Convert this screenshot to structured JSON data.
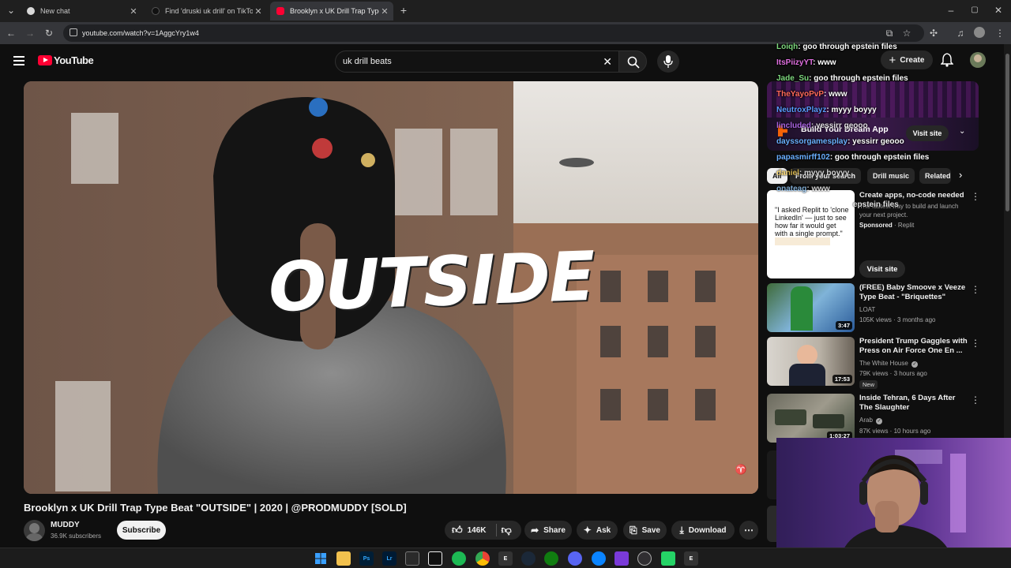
{
  "browser": {
    "tabs": [
      {
        "title": "New chat",
        "favicon_color": "#d9d9d9"
      },
      {
        "title": "Find 'druski uk drill' on TikTok |",
        "favicon_color": "#111111"
      },
      {
        "title": "Brooklyn x UK Drill Trap Type Be",
        "favicon_color": "#ff0033"
      }
    ],
    "new_tab": "+",
    "url": "youtube.com/watch?v=1AggcYry1w4"
  },
  "youtube": {
    "logo_text": "YouTube",
    "search_value": "uk drill beats",
    "create_label": "Create",
    "video": {
      "overlay_word": "OUTSIDE",
      "title": "Brooklyn x UK Drill Trap Type Beat \"OUTSIDE\" | 2020 | @PRODMUDDY [SOLD]",
      "channel": "MUDDY",
      "subscribers": "36.9K subscribers",
      "subscribe_label": "Subscribe",
      "likes": "146K",
      "share_label": "Share",
      "ask_label": "Ask",
      "save_label": "Save",
      "download_label": "Download"
    },
    "ad_banner": {
      "title": "Build Your Dream App",
      "button": "Visit site"
    },
    "chips": [
      "All",
      "From your search",
      "Drill music",
      "Related"
    ],
    "sponsored": {
      "thumb_text": "\"I asked Replit to 'clone LinkedIn' — just to see how far it would get with a single prompt.\"",
      "title": "Create apps, no-code needed",
      "desc": "The fastest way to build and launch your next project.",
      "sponsored_label": "Sponsored",
      "advertiser": "Replit",
      "button": "Visit site"
    },
    "recommendations": [
      {
        "title": "(FREE) Baby Smoove x Veeze Type Beat - \"Briquettes\"",
        "channel": "LOAT",
        "meta": "105K views · 3 months ago",
        "duration": "3:47",
        "badge": ""
      },
      {
        "title": "President Trump Gaggles with Press on Air Force One En ...",
        "channel": "The White House",
        "meta": "79K views · 3 hours ago",
        "duration": "17:53",
        "badge": "New"
      },
      {
        "title": "Inside Tehran, 6 Days After The Slaughter",
        "channel": "Arab",
        "meta": "87K views · 10 hours ago",
        "duration": "1:03:27",
        "badge": ""
      }
    ]
  },
  "chat": [
    {
      "user": "Loiqh",
      "color": "#7dd87d",
      "msg": "goo through epstein files"
    },
    {
      "user": "ItsPiizyYT",
      "color": "#e070e0",
      "msg": "www"
    },
    {
      "user": "Jade_Su",
      "color": "#7dd87d",
      "msg": "goo through epstein files"
    },
    {
      "user": "TheYayoPvP",
      "color": "#ff6a5a",
      "msg": "www"
    },
    {
      "user": "NeutroxPlayz",
      "color": "#5a9cff",
      "msg": "myyy boyyy"
    },
    {
      "user": "lincluded",
      "color": "#c070ff",
      "msg": "yessirr geooo"
    },
    {
      "user": "dayssorgamesplay",
      "color": "#6ab0ff",
      "msg": "yessirr geooo"
    },
    {
      "user": "papasmirff102",
      "color": "#6ab0ff",
      "msg": "goo through epstein files"
    },
    {
      "user": "daniel",
      "color": "#ffd75a",
      "msg": "myyy boyyy"
    },
    {
      "user": "onateag",
      "color": "#9ad0ff",
      "msg": "www"
    },
    {
      "user": "",
      "color": "#ffffff",
      "msg": "epstein files"
    }
  ],
  "taskbar": {
    "icons": [
      "windows-start",
      "file-explorer",
      "Ps",
      "Lr",
      "store",
      "capcut",
      "spotify",
      "chrome",
      "epic",
      "steam",
      "xbox-chat",
      "discord",
      "messenger",
      "app",
      "obs",
      "whatsapp",
      "epic"
    ]
  }
}
